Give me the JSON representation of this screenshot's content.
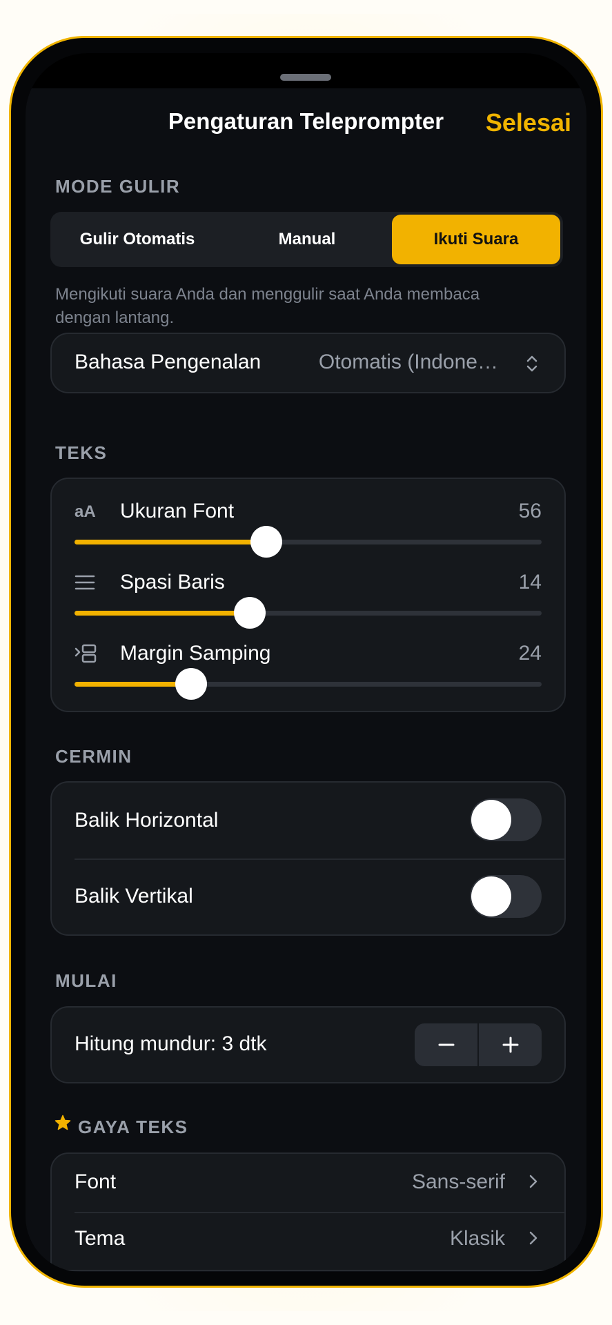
{
  "header": {
    "title": "Pengaturan Teleprompter",
    "done": "Selesai"
  },
  "scroll_mode": {
    "label": "MODE GULIR",
    "options": [
      "Gulir Otomatis",
      "Manual",
      "Ikuti Suara"
    ],
    "selected": "Ikuti Suara",
    "description": "Mengikuti suara Anda dan menggulir saat Anda membaca dengan lantang."
  },
  "language": {
    "label": "Bahasa Pengenalan",
    "value": "Otomatis (Indone…"
  },
  "text": {
    "label": "TEKS",
    "sliders": [
      {
        "label": "Ukuran Font",
        "value": "56",
        "fraction": 0.41,
        "icon": "font-size-icon",
        "icon_text": "aA"
      },
      {
        "label": "Spasi Baris",
        "value": "14",
        "fraction": 0.375,
        "icon": "line-spacing-icon"
      },
      {
        "label": "Margin Samping",
        "value": "24",
        "fraction": 0.25,
        "icon": "margin-icon"
      }
    ]
  },
  "mirror": {
    "label": "CERMIN",
    "flip_horizontal": {
      "label": "Balik Horizontal",
      "on": false
    },
    "flip_vertical": {
      "label": "Balik Vertikal",
      "on": false
    }
  },
  "start": {
    "label": "MULAI",
    "countdown": "Hitung mundur: 3 dtk"
  },
  "text_style": {
    "label": "GAYA TEKS",
    "font": {
      "label": "Font",
      "value": "Sans-serif"
    },
    "theme": {
      "label": "Tema",
      "value": "Klasik"
    }
  },
  "colors": {
    "accent": "#f2b200",
    "background": "#0c0e12",
    "card": "#15181c",
    "muted_text": "#9aa0aa"
  }
}
